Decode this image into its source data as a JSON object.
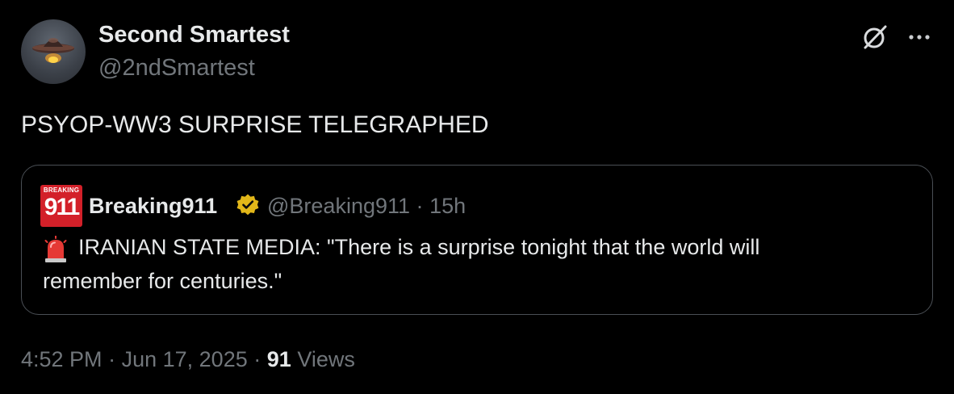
{
  "tweet": {
    "author": {
      "display_name": "Second Smartest",
      "handle": "@2ndSmartest",
      "avatar": "ufo-avatar"
    },
    "actions": {
      "grok_icon": "grok-icon",
      "more_icon": "more-icon"
    },
    "text": "PSYOP-WW3 SURPRISE TELEGRAPHED",
    "quoted": {
      "avatar": {
        "line1": "BREAKING",
        "line2": "911",
        "color": "#d32029"
      },
      "display_name": "Breaking911",
      "verified_badge_color": "#e2b719",
      "handle": "@Breaking911",
      "separator": "·",
      "time": "15h",
      "emoji": "siren-icon",
      "text_line1": "IRANIAN STATE MEDIA: \"There is a surprise tonight that the world will",
      "text_line2": "remember for centuries.\""
    },
    "footer": {
      "time": "4:52 PM",
      "sep1": "·",
      "date": "Jun 17, 2025",
      "sep2": "·",
      "views_count": "91",
      "views_label": "Views"
    }
  },
  "colors": {
    "background": "#000000",
    "primary_text": "#e7e9ea",
    "secondary_text": "#71767b",
    "border": "#4a4f55"
  }
}
